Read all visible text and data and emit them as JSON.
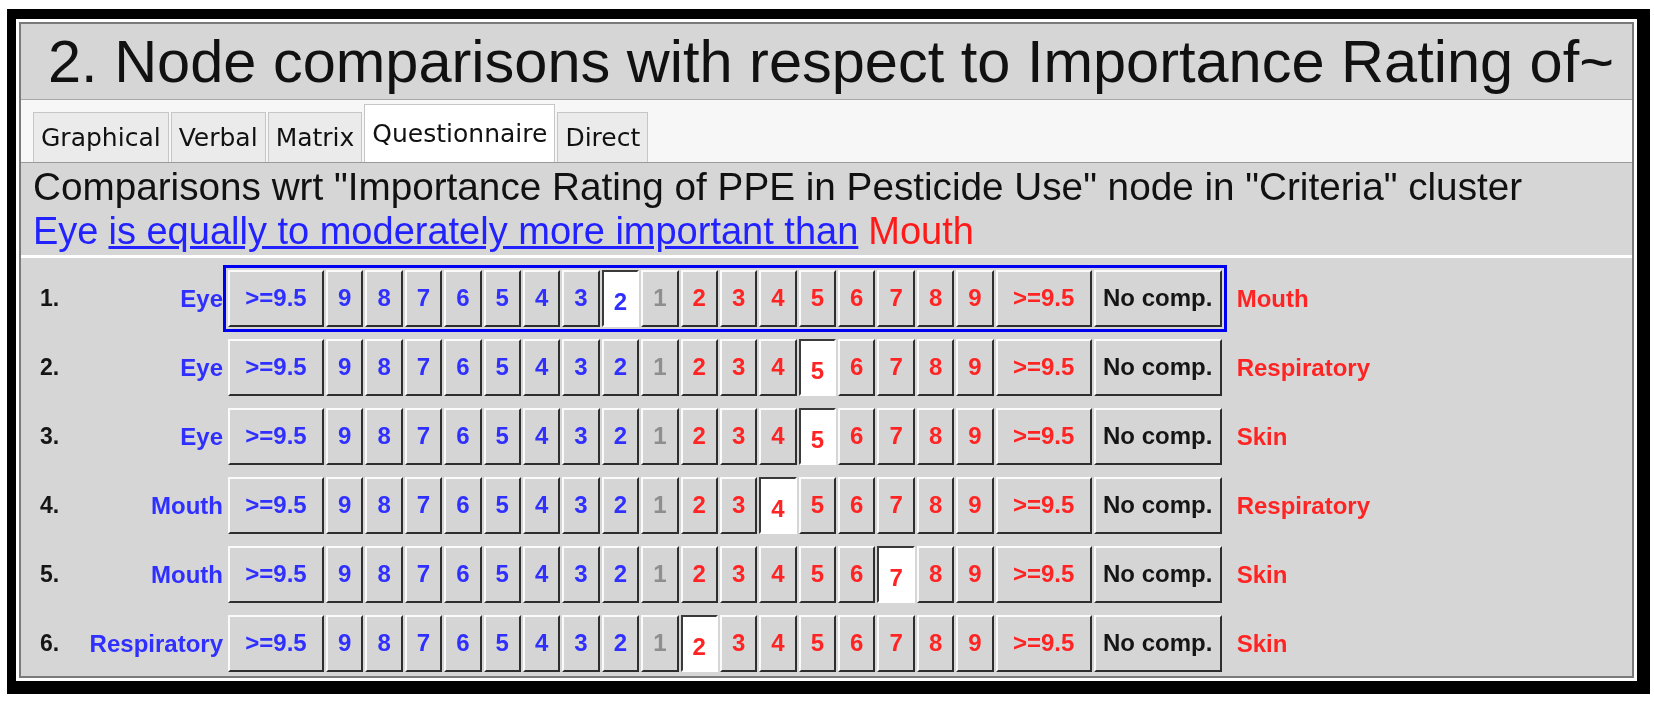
{
  "window": {
    "title": "2. Node comparisons with respect to Importance Rating of~"
  },
  "tabs": [
    {
      "label": "Graphical",
      "selected": false
    },
    {
      "label": "Verbal",
      "selected": false
    },
    {
      "label": "Matrix",
      "selected": false
    },
    {
      "label": "Questionnaire",
      "selected": true
    },
    {
      "label": "Direct",
      "selected": false
    }
  ],
  "description": {
    "heading": "Comparisons wrt \"Importance Rating of PPE in Pesticide Use\" node in \"Criteria\" cluster",
    "left_node": "Eye",
    "verdict": "is equally to moderately more important than",
    "right_node": "Mouth"
  },
  "rows": [
    {
      "number": "1.",
      "left": "Eye",
      "right": "Mouth",
      "focused": true,
      "buttons": [
        {
          "label": ">=9.5",
          "kind": "leftmax",
          "selected": false
        },
        {
          "label": "9",
          "kind": "left",
          "selected": false
        },
        {
          "label": "8",
          "kind": "left",
          "selected": false
        },
        {
          "label": "7",
          "kind": "left",
          "selected": false
        },
        {
          "label": "6",
          "kind": "left",
          "selected": false
        },
        {
          "label": "5",
          "kind": "left",
          "selected": false
        },
        {
          "label": "4",
          "kind": "left",
          "selected": false
        },
        {
          "label": "3",
          "kind": "left",
          "selected": false
        },
        {
          "label": "2",
          "kind": "left",
          "selected": true
        },
        {
          "label": "1",
          "kind": "equal",
          "selected": false
        },
        {
          "label": "2",
          "kind": "right",
          "selected": false
        },
        {
          "label": "3",
          "kind": "right",
          "selected": false
        },
        {
          "label": "4",
          "kind": "right",
          "selected": false
        },
        {
          "label": "5",
          "kind": "right",
          "selected": false
        },
        {
          "label": "6",
          "kind": "right",
          "selected": false
        },
        {
          "label": "7",
          "kind": "right",
          "selected": false
        },
        {
          "label": "8",
          "kind": "right",
          "selected": false
        },
        {
          "label": "9",
          "kind": "right",
          "selected": false
        },
        {
          "label": ">=9.5",
          "kind": "rightmax",
          "selected": false
        },
        {
          "label": "No comp.",
          "kind": "skip",
          "selected": false
        }
      ]
    },
    {
      "number": "2.",
      "left": "Eye",
      "right": "Respiratory",
      "focused": false,
      "buttons": [
        {
          "label": ">=9.5",
          "kind": "leftmax",
          "selected": false
        },
        {
          "label": "9",
          "kind": "left",
          "selected": false
        },
        {
          "label": "8",
          "kind": "left",
          "selected": false
        },
        {
          "label": "7",
          "kind": "left",
          "selected": false
        },
        {
          "label": "6",
          "kind": "left",
          "selected": false
        },
        {
          "label": "5",
          "kind": "left",
          "selected": false
        },
        {
          "label": "4",
          "kind": "left",
          "selected": false
        },
        {
          "label": "3",
          "kind": "left",
          "selected": false
        },
        {
          "label": "2",
          "kind": "left",
          "selected": false
        },
        {
          "label": "1",
          "kind": "equal",
          "selected": false
        },
        {
          "label": "2",
          "kind": "right",
          "selected": false
        },
        {
          "label": "3",
          "kind": "right",
          "selected": false
        },
        {
          "label": "4",
          "kind": "right",
          "selected": false
        },
        {
          "label": "5",
          "kind": "right",
          "selected": true
        },
        {
          "label": "6",
          "kind": "right",
          "selected": false
        },
        {
          "label": "7",
          "kind": "right",
          "selected": false
        },
        {
          "label": "8",
          "kind": "right",
          "selected": false
        },
        {
          "label": "9",
          "kind": "right",
          "selected": false
        },
        {
          "label": ">=9.5",
          "kind": "rightmax",
          "selected": false
        },
        {
          "label": "No comp.",
          "kind": "skip",
          "selected": false
        }
      ]
    },
    {
      "number": "3.",
      "left": "Eye",
      "right": "Skin",
      "focused": false,
      "buttons": [
        {
          "label": ">=9.5",
          "kind": "leftmax",
          "selected": false
        },
        {
          "label": "9",
          "kind": "left",
          "selected": false
        },
        {
          "label": "8",
          "kind": "left",
          "selected": false
        },
        {
          "label": "7",
          "kind": "left",
          "selected": false
        },
        {
          "label": "6",
          "kind": "left",
          "selected": false
        },
        {
          "label": "5",
          "kind": "left",
          "selected": false
        },
        {
          "label": "4",
          "kind": "left",
          "selected": false
        },
        {
          "label": "3",
          "kind": "left",
          "selected": false
        },
        {
          "label": "2",
          "kind": "left",
          "selected": false
        },
        {
          "label": "1",
          "kind": "equal",
          "selected": false
        },
        {
          "label": "2",
          "kind": "right",
          "selected": false
        },
        {
          "label": "3",
          "kind": "right",
          "selected": false
        },
        {
          "label": "4",
          "kind": "right",
          "selected": false
        },
        {
          "label": "5",
          "kind": "right",
          "selected": true
        },
        {
          "label": "6",
          "kind": "right",
          "selected": false
        },
        {
          "label": "7",
          "kind": "right",
          "selected": false
        },
        {
          "label": "8",
          "kind": "right",
          "selected": false
        },
        {
          "label": "9",
          "kind": "right",
          "selected": false
        },
        {
          "label": ">=9.5",
          "kind": "rightmax",
          "selected": false
        },
        {
          "label": "No comp.",
          "kind": "skip",
          "selected": false
        }
      ]
    },
    {
      "number": "4.",
      "left": "Mouth",
      "right": "Respiratory",
      "focused": false,
      "buttons": [
        {
          "label": ">=9.5",
          "kind": "leftmax",
          "selected": false
        },
        {
          "label": "9",
          "kind": "left",
          "selected": false
        },
        {
          "label": "8",
          "kind": "left",
          "selected": false
        },
        {
          "label": "7",
          "kind": "left",
          "selected": false
        },
        {
          "label": "6",
          "kind": "left",
          "selected": false
        },
        {
          "label": "5",
          "kind": "left",
          "selected": false
        },
        {
          "label": "4",
          "kind": "left",
          "selected": false
        },
        {
          "label": "3",
          "kind": "left",
          "selected": false
        },
        {
          "label": "2",
          "kind": "left",
          "selected": false
        },
        {
          "label": "1",
          "kind": "equal",
          "selected": false
        },
        {
          "label": "2",
          "kind": "right",
          "selected": false
        },
        {
          "label": "3",
          "kind": "right",
          "selected": false
        },
        {
          "label": "4",
          "kind": "right",
          "selected": true
        },
        {
          "label": "5",
          "kind": "right",
          "selected": false
        },
        {
          "label": "6",
          "kind": "right",
          "selected": false
        },
        {
          "label": "7",
          "kind": "right",
          "selected": false
        },
        {
          "label": "8",
          "kind": "right",
          "selected": false
        },
        {
          "label": "9",
          "kind": "right",
          "selected": false
        },
        {
          "label": ">=9.5",
          "kind": "rightmax",
          "selected": false
        },
        {
          "label": "No comp.",
          "kind": "skip",
          "selected": false
        }
      ]
    },
    {
      "number": "5.",
      "left": "Mouth",
      "right": "Skin",
      "focused": false,
      "buttons": [
        {
          "label": ">=9.5",
          "kind": "leftmax",
          "selected": false
        },
        {
          "label": "9",
          "kind": "left",
          "selected": false
        },
        {
          "label": "8",
          "kind": "left",
          "selected": false
        },
        {
          "label": "7",
          "kind": "left",
          "selected": false
        },
        {
          "label": "6",
          "kind": "left",
          "selected": false
        },
        {
          "label": "5",
          "kind": "left",
          "selected": false
        },
        {
          "label": "4",
          "kind": "left",
          "selected": false
        },
        {
          "label": "3",
          "kind": "left",
          "selected": false
        },
        {
          "label": "2",
          "kind": "left",
          "selected": false
        },
        {
          "label": "1",
          "kind": "equal",
          "selected": false
        },
        {
          "label": "2",
          "kind": "right",
          "selected": false
        },
        {
          "label": "3",
          "kind": "right",
          "selected": false
        },
        {
          "label": "4",
          "kind": "right",
          "selected": false
        },
        {
          "label": "5",
          "kind": "right",
          "selected": false
        },
        {
          "label": "6",
          "kind": "right",
          "selected": false
        },
        {
          "label": "7",
          "kind": "right",
          "selected": true
        },
        {
          "label": "8",
          "kind": "right",
          "selected": false
        },
        {
          "label": "9",
          "kind": "right",
          "selected": false
        },
        {
          "label": ">=9.5",
          "kind": "rightmax",
          "selected": false
        },
        {
          "label": "No comp.",
          "kind": "skip",
          "selected": false
        }
      ]
    },
    {
      "number": "6.",
      "left": "Respiratory",
      "right": "Skin",
      "focused": false,
      "buttons": [
        {
          "label": ">=9.5",
          "kind": "leftmax",
          "selected": false
        },
        {
          "label": "9",
          "kind": "left",
          "selected": false
        },
        {
          "label": "8",
          "kind": "left",
          "selected": false
        },
        {
          "label": "7",
          "kind": "left",
          "selected": false
        },
        {
          "label": "6",
          "kind": "left",
          "selected": false
        },
        {
          "label": "5",
          "kind": "left",
          "selected": false
        },
        {
          "label": "4",
          "kind": "left",
          "selected": false
        },
        {
          "label": "3",
          "kind": "left",
          "selected": false
        },
        {
          "label": "2",
          "kind": "left",
          "selected": false
        },
        {
          "label": "1",
          "kind": "equal",
          "selected": false
        },
        {
          "label": "2",
          "kind": "right",
          "selected": true
        },
        {
          "label": "3",
          "kind": "right",
          "selected": false
        },
        {
          "label": "4",
          "kind": "right",
          "selected": false
        },
        {
          "label": "5",
          "kind": "right",
          "selected": false
        },
        {
          "label": "6",
          "kind": "right",
          "selected": false
        },
        {
          "label": "7",
          "kind": "right",
          "selected": false
        },
        {
          "label": "8",
          "kind": "right",
          "selected": false
        },
        {
          "label": "9",
          "kind": "right",
          "selected": false
        },
        {
          "label": ">=9.5",
          "kind": "rightmax",
          "selected": false
        },
        {
          "label": "No comp.",
          "kind": "skip",
          "selected": false
        }
      ]
    }
  ]
}
